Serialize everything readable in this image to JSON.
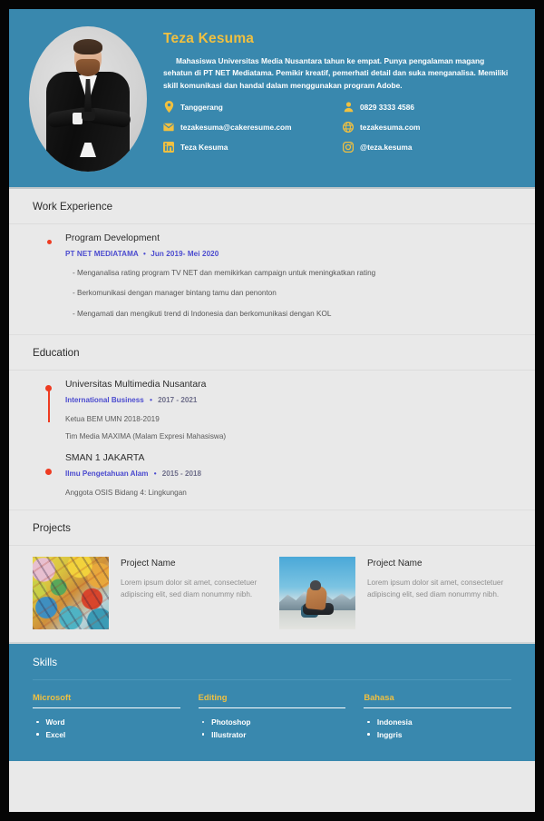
{
  "colors": {
    "accent_teal": "#3988ae",
    "accent_yellow": "#f0c040",
    "accent_red": "#ee3b21",
    "link_blue": "#4b4bcf",
    "page_bg": "#e9e9e9"
  },
  "header": {
    "name": "Teza Kesuma",
    "summary": "Mahasiswa Universitas Media Nusantara tahun ke empat. Punya pengalaman magang sehatun di PT NET Mediatama. Pemikir kreatif, pemerhati detail dan suka menganalisa. Memiliki skill komunikasi dan handal dalam menggunakan program Adobe.",
    "avatar_alt": "Portrait of man in black suit with arms crossed",
    "contacts": [
      {
        "icon": "location-pin-icon",
        "value": "Tanggerang"
      },
      {
        "icon": "person-phone-icon",
        "value": "0829 3333 4586"
      },
      {
        "icon": "mail-icon",
        "value": "tezakesuma@cakeresume.com"
      },
      {
        "icon": "globe-icon",
        "value": "tezakesuma.com"
      },
      {
        "icon": "linkedin-icon",
        "value": "Teza Kesuma"
      },
      {
        "icon": "instagram-icon",
        "value": "@teza.kesuma"
      }
    ]
  },
  "work_experience": {
    "title": "Work Experience",
    "jobs": [
      {
        "title": "Program Development",
        "company": "PT NET MEDIATAMA",
        "separator": "•",
        "dates": "Jun 2019- Mei 2020",
        "bullets": [
          "- Menganalisa rating program TV NET dan memikirkan campaign untuk meningkatkan rating",
          "- Berkomunikasi dengan manager bintang tamu dan penonton",
          "- Mengamati dan mengikuti trend di Indonesia dan berkomunikasi dengan KOL"
        ]
      }
    ]
  },
  "education": {
    "title": "Education",
    "items": [
      {
        "school": "Universitas Multimedia Nusantara",
        "major": "International Business",
        "separator": "•",
        "years": "2017 - 2021",
        "notes": [
          "Ketua BEM UMN 2018-2019",
          "Tim Media MAXIMA (Malam Expresi Mahasiswa)"
        ]
      },
      {
        "school": "SMAN 1 JAKARTA",
        "major": "Ilmu Pengetahuan Alam",
        "separator": "•",
        "years": "2015 - 2018",
        "notes": [
          "Anggota OSIS Bidang 4: Lingkungan"
        ]
      }
    ]
  },
  "projects": {
    "title": "Projects",
    "items": [
      {
        "name": "Project Name",
        "description": "Lorem ipsum dolor sit amet, consectetuer adipiscing elit, sed diam nonummy nibh.",
        "thumb_alt": "Colorful graffiti abstract artwork"
      },
      {
        "name": "Project Name",
        "description": "Lorem ipsum dolor sit amet, consectetuer adipiscing elit, sed diam nonummy nibh.",
        "thumb_alt": "Person sitting on mountain ridge with snowy peaks"
      }
    ]
  },
  "skills": {
    "title": "Skills",
    "categories": [
      {
        "label": "Microsoft",
        "items": [
          "Word",
          "Excel"
        ]
      },
      {
        "label": "Editing",
        "items": [
          "Photoshop",
          "Illustrator"
        ]
      },
      {
        "label": "Bahasa",
        "items": [
          "Indonesia",
          "Inggris"
        ]
      }
    ]
  }
}
